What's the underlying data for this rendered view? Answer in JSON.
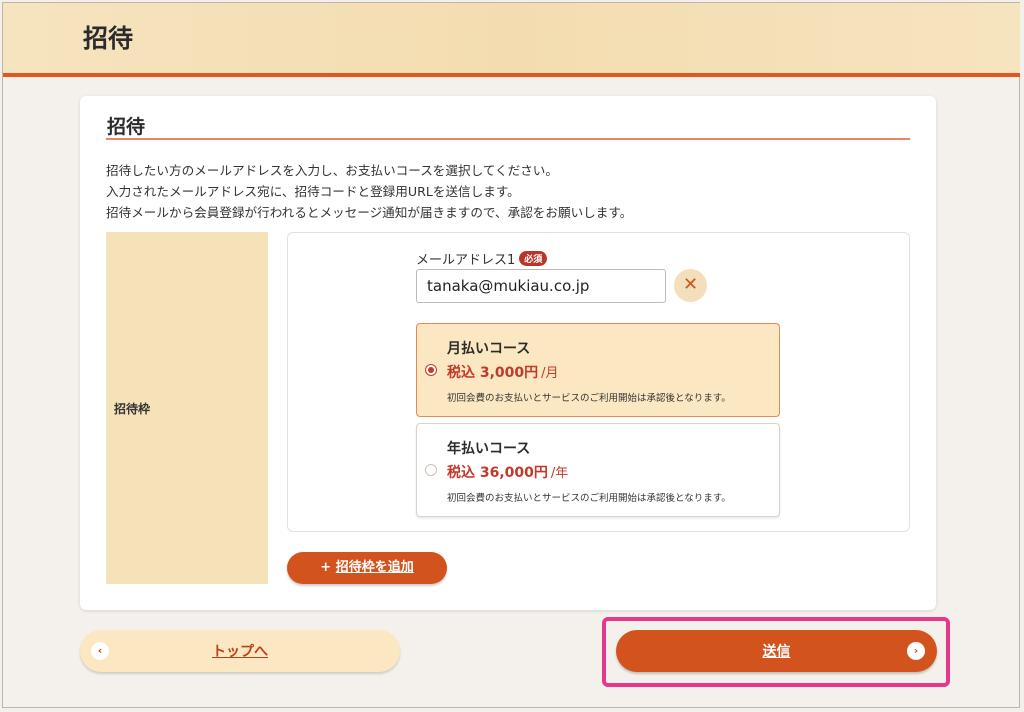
{
  "header": {
    "title": "招待"
  },
  "section": {
    "title": "招待",
    "description": [
      "招待したい方のメールアドレスを入力し、お支払いコースを選択してください。",
      "入力されたメールアドレス宛に、招待コードと登録用URLを送信します。",
      "招待メールから会員登録が行われるとメッセージ通知が届きますので、承認をお願いします。"
    ]
  },
  "form": {
    "row_label": "招待枠",
    "email": {
      "label": "メールアドレス1",
      "required_badge": "必須",
      "value": "tanaka@mukiau.co.jp",
      "clear_icon": "close-icon"
    },
    "courses": [
      {
        "name": "月払いコース",
        "price": "税込 3,000円",
        "unit": "/月",
        "note": "初回会費のお支払いとサービスのご利用開始は承認後となります。",
        "selected": true
      },
      {
        "name": "年払いコース",
        "price": "税込 36,000円",
        "unit": "/年",
        "note": "初回会費のお支払いとサービスのご利用開始は承認後となります。",
        "selected": false
      }
    ],
    "add_button": {
      "icon": "+",
      "label": "招待枠を追加"
    }
  },
  "footer": {
    "top_button": {
      "label": "トップへ",
      "icon": "‹"
    },
    "send_button": {
      "label": "送信",
      "icon": "›"
    }
  },
  "colors": {
    "accent": "#d3531f",
    "header_rule": "#e2571d",
    "price": "#c0392b",
    "highlight": "#e5388c"
  }
}
